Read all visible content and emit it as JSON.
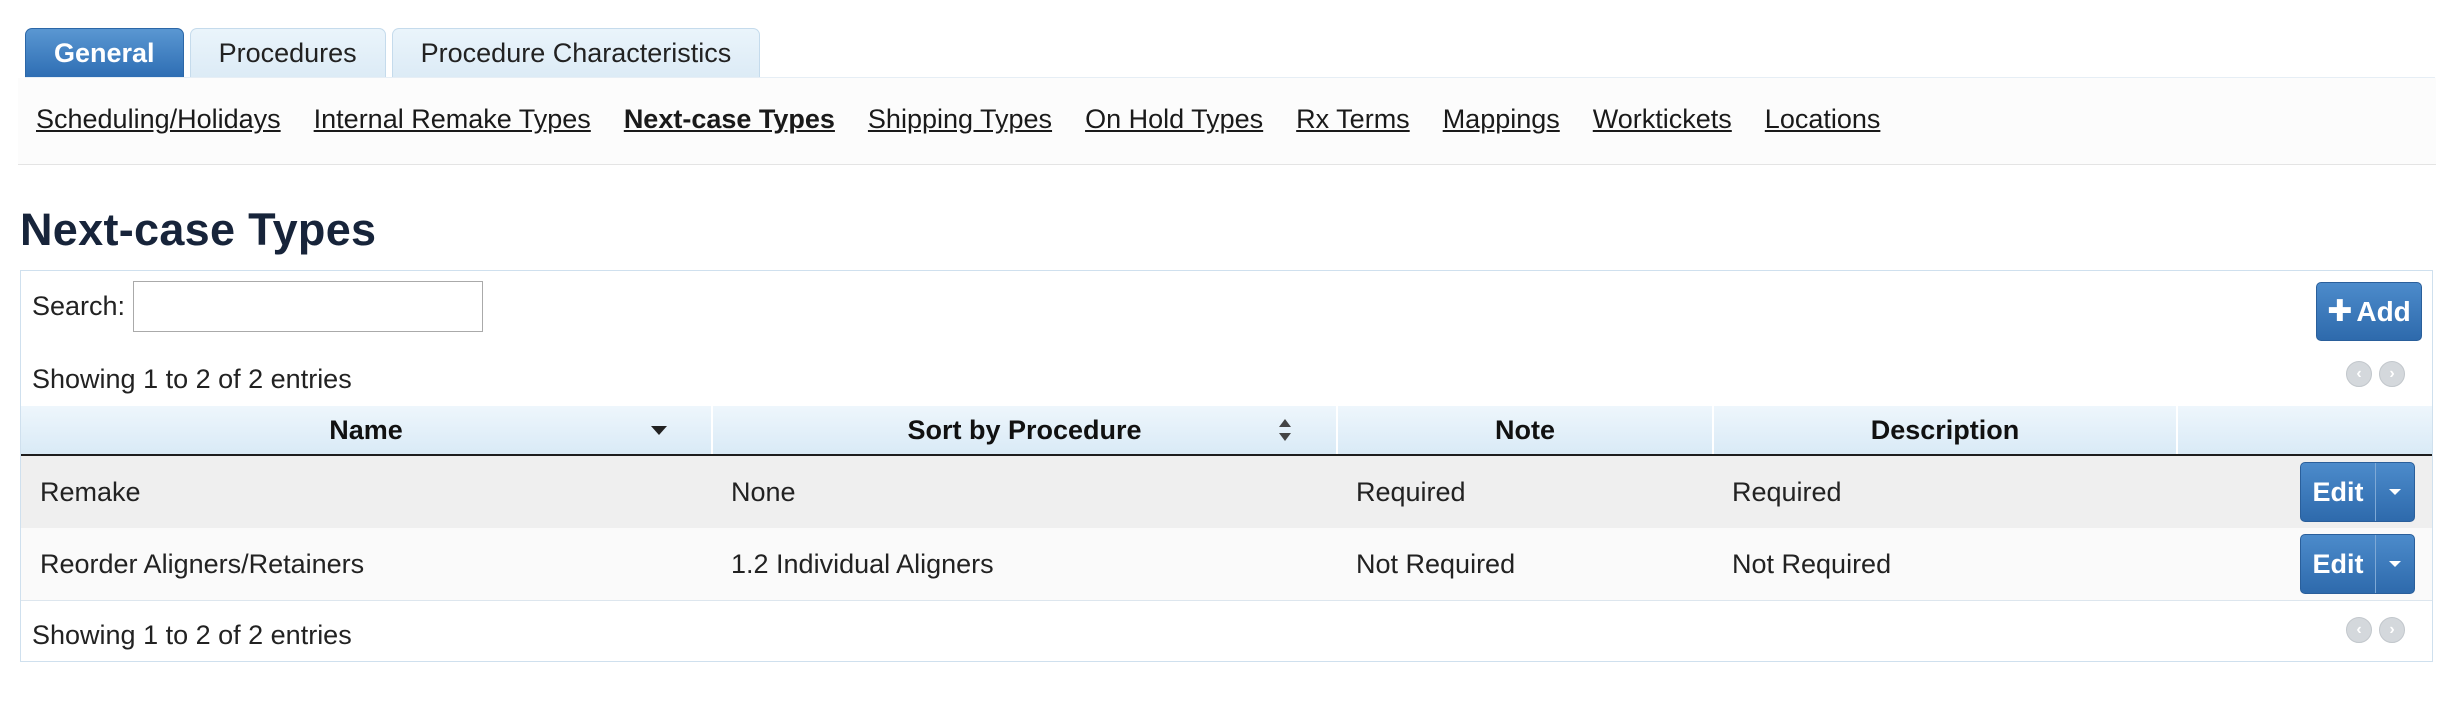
{
  "tabs": [
    {
      "label": "General",
      "active": true
    },
    {
      "label": "Procedures",
      "active": false
    },
    {
      "label": "Procedure Characteristics",
      "active": false
    }
  ],
  "subnav": [
    {
      "label": "Scheduling/Holidays",
      "current": false
    },
    {
      "label": "Internal Remake Types",
      "current": false
    },
    {
      "label": "Next-case Types",
      "current": true
    },
    {
      "label": "Shipping Types",
      "current": false
    },
    {
      "label": "On Hold Types",
      "current": false
    },
    {
      "label": "Rx Terms",
      "current": false
    },
    {
      "label": "Mappings",
      "current": false
    },
    {
      "label": "Worktickets",
      "current": false
    },
    {
      "label": "Locations",
      "current": false
    }
  ],
  "page_title": "Next-case Types",
  "search": {
    "label": "Search:",
    "value": "",
    "placeholder": ""
  },
  "add_button": {
    "label": "Add",
    "icon": "plus-icon"
  },
  "info_top": "Showing 1 to 2 of 2 entries",
  "info_bottom": "Showing 1 to 2 of 2 entries",
  "table": {
    "columns": [
      {
        "label": "Name",
        "sort": "desc"
      },
      {
        "label": "Sort by Procedure",
        "sort": "both"
      },
      {
        "label": "Note",
        "sort": ""
      },
      {
        "label": "Description",
        "sort": ""
      },
      {
        "label": "",
        "sort": ""
      }
    ],
    "rows": [
      {
        "name": "Remake",
        "sort_by_procedure": "None",
        "note": "Required",
        "description": "Required",
        "action": "Edit"
      },
      {
        "name": "Reorder Aligners/Retainers",
        "sort_by_procedure": "1.2 Individual Aligners",
        "note": "Not Required",
        "description": "Not Required",
        "action": "Edit"
      }
    ]
  },
  "colors": {
    "accent": "#2e6aac",
    "title": "#17243a",
    "tab_inactive": "#dcebf6"
  }
}
